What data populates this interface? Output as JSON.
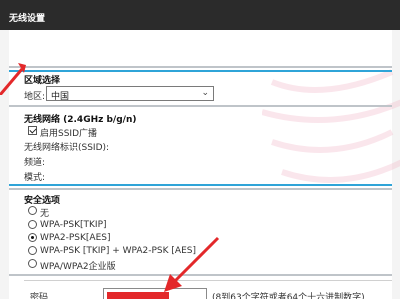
{
  "window": {
    "title": "无线设置"
  },
  "region": {
    "title": "区域选择",
    "label": "地区:",
    "selected": "中国"
  },
  "wireless": {
    "title": "无线网络 (2.4GHz b/g/n)",
    "ssid_broadcast_label": "启用SSID广播",
    "ssid_broadcast_checked": true,
    "ssid_label": "无线网络标识(SSID):",
    "channel_label": "频道:",
    "mode_label": "模式:"
  },
  "security": {
    "title": "安全选项",
    "options": [
      "无",
      "WPA-PSK[TKIP]",
      "WPA2-PSK[AES]",
      "WPA-PSK [TKIP] + WPA2-PSK [AES]",
      "WPA/WPA2企业版"
    ],
    "selected_index": 2
  },
  "password": {
    "label": "密码",
    "hint": "(8到63个字符或者64个十六进制数字)"
  },
  "colors": {
    "titlebar": "#2b2b2b",
    "accent_line": "#2fa4d8",
    "annotation_arrow": "#e3282a"
  }
}
